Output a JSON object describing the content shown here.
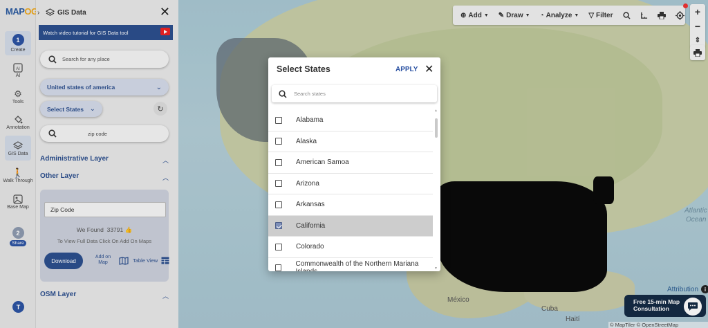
{
  "app": {
    "logo_text": "MAPOG",
    "logo_part1": "MAP",
    "logo_part2": "OG"
  },
  "rail": {
    "create": {
      "step": "1",
      "label": "Create"
    },
    "items": [
      {
        "label": "AI",
        "icon": "ai-icon"
      },
      {
        "label": "Tools",
        "icon": "gear-icon"
      },
      {
        "label": "Annotation",
        "icon": "paint-bucket-icon"
      },
      {
        "label": "GIS Data",
        "icon": "layers-icon"
      },
      {
        "label": "Walk Through",
        "icon": "walk-icon"
      },
      {
        "label": "Base Map",
        "icon": "basemap-icon"
      }
    ],
    "share": {
      "step": "2",
      "label": "Share"
    },
    "user_initial": "T"
  },
  "panel": {
    "title": "GIS Data",
    "tutorial_text": "Watch video tutorial for GIS Data tool",
    "search_placeholder": "Search for any place",
    "country_select": "United states of america",
    "states_select": "Select States",
    "zip_search": "zip code",
    "sections": {
      "administrative": "Administrative Layer",
      "other": "Other Layer",
      "osm": "OSM Layer"
    },
    "zip_card": {
      "input_value": "Zip Code",
      "found_label": "We Found",
      "found_count": "33791",
      "view_text": "To View Full Data Click On Add On Maps",
      "download": "Download",
      "add_on_map": "Add on Map",
      "table_view": "Table View"
    }
  },
  "toolbar": {
    "add": "Add",
    "draw": "Draw",
    "analyze": "Analyze",
    "filter": "Filter"
  },
  "map": {
    "labels": {
      "mexico": "México",
      "cuba": "Cuba",
      "haiti": "Haití",
      "atlantic": "Atlantic",
      "ocean": "Ocean"
    },
    "attribution": "Attribution",
    "consult_line1": "Free 15-min Map",
    "consult_line2": "Consultation",
    "copyright": "© MapTiler © OpenStreetMap contributors"
  },
  "modal": {
    "title": "Select States",
    "apply": "APPLY",
    "search_placeholder": "Search states",
    "states": [
      {
        "name": "Alabama",
        "checked": false
      },
      {
        "name": "Alaska",
        "checked": false
      },
      {
        "name": "American Samoa",
        "checked": false
      },
      {
        "name": "Arizona",
        "checked": false
      },
      {
        "name": "Arkansas",
        "checked": false
      },
      {
        "name": "California",
        "checked": true
      },
      {
        "name": "Colorado",
        "checked": false
      },
      {
        "name": "Commonwealth of the Northern Mariana Islands",
        "checked": false
      }
    ]
  },
  "colors": {
    "accent": "#2c53a3",
    "panel_blue": "#2c4f8e",
    "selected_row": "#cdcdcd"
  }
}
